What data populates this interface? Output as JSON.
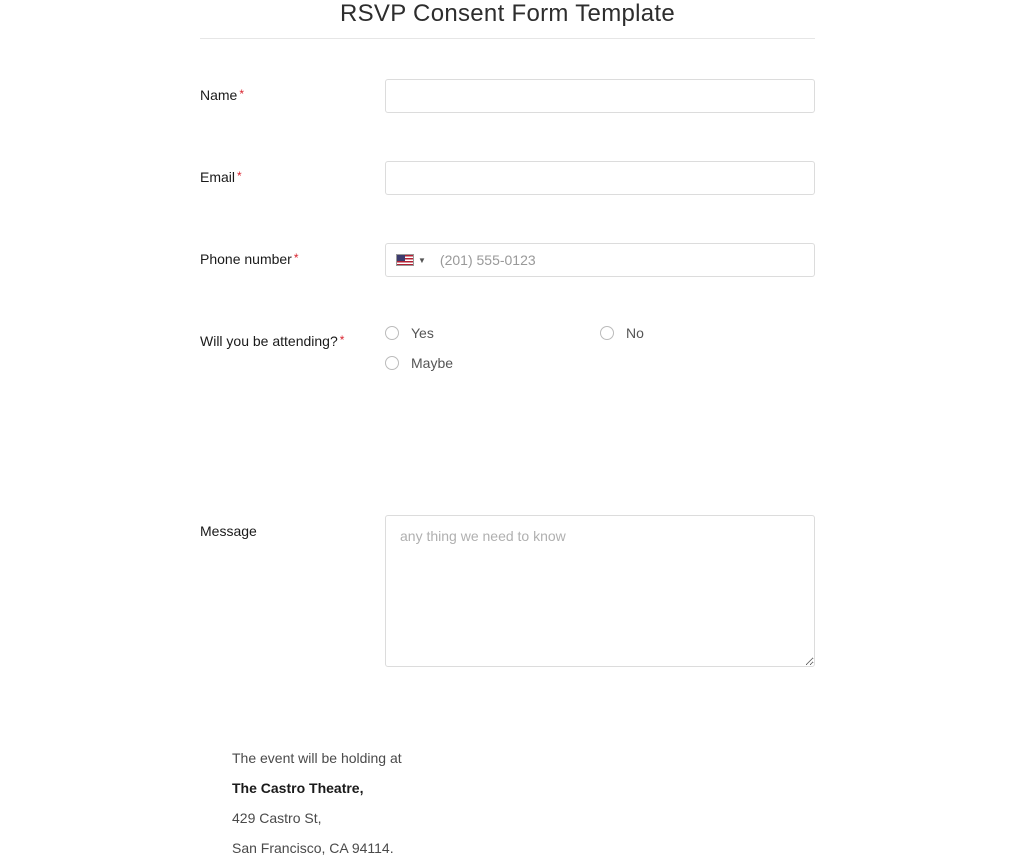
{
  "title": "RSVP Consent Form Template",
  "fields": {
    "name": {
      "label": "Name",
      "required": true
    },
    "email": {
      "label": "Email",
      "required": true
    },
    "phone": {
      "label": "Phone number",
      "required": true,
      "placeholder": "(201) 555-0123"
    },
    "attending": {
      "label": "Will you be attending?",
      "required": true,
      "options": {
        "yes": "Yes",
        "no": "No",
        "maybe": "Maybe"
      }
    },
    "message": {
      "label": "Message",
      "placeholder": "any thing we need to know"
    }
  },
  "event": {
    "intro": "The event will be holding at",
    "venue": "The Castro Theatre,",
    "street": "429 Castro St,",
    "city": "San Francisco, CA 94114."
  }
}
